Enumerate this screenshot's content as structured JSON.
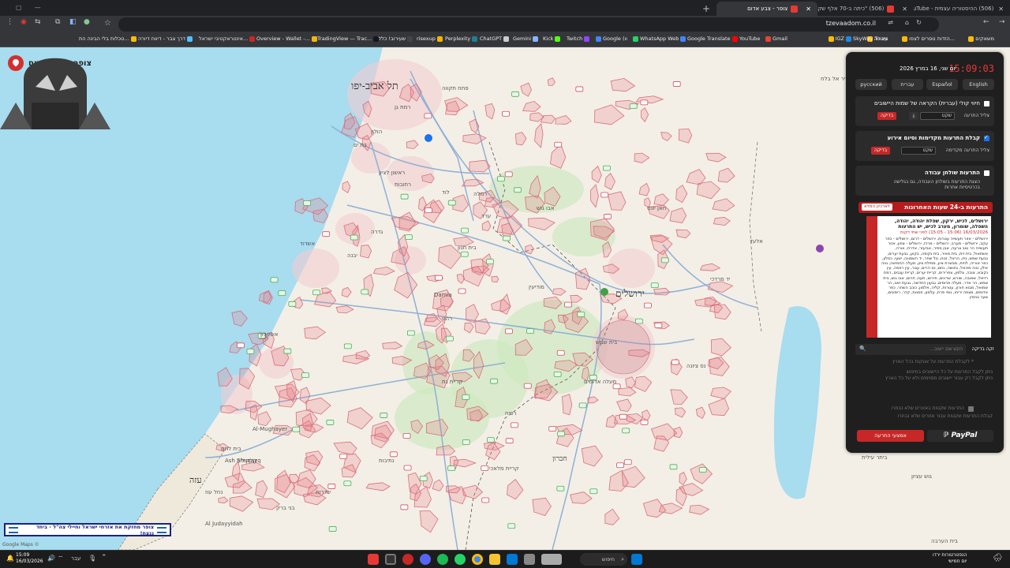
{
  "browser": {
    "tabs": [
      {
        "title": "(506) ההיסטוריה עצמית - YouTube",
        "active": false
      },
      {
        "title": "(506) \"כיתה ב-70 אלף שקל!\" ס...",
        "active": false
      },
      {
        "title": "צופר - צבע אדום",
        "active": true
      }
    ],
    "url": "tzevaadom.co.il",
    "bookmarks": [
      "משאקים",
      "הזדות נוסרים לצפו...",
      "עבודה",
      "IGZ",
      "SkyWay Tours",
      "Gmail",
      "YouTube",
      "Google Translate",
      "WhatsApp Web",
      "Google (וו",
      "Twitch",
      "Kick",
      "Gemini",
      "ChatGPT",
      "Perplexity",
      "risexup",
      "שעירוב! כללי",
      "TradingView — Trac...",
      "Overview - Wallet -...",
      "אינטראקטיבי ישראל...",
      "דרך צבר - דיווח דיורה",
      "טכלות בלי הבינה הת..."
    ]
  },
  "app": {
    "name": "צופר - צבע אדום",
    "banner": "צופר מחזקת את אזרחי ישראל וחיילי צה\"ל - ביחד ננצח!",
    "map_credit": "Google Maps ©"
  },
  "map": {
    "cities": [
      {
        "name": "תל אביב-יפו",
        "size": "big"
      },
      {
        "name": "ירושלים",
        "size": "big"
      },
      {
        "name": "עזה",
        "size": "mid"
      },
      {
        "name": "חברון",
        "size": "mid"
      }
    ],
    "places": [
      "רמת גן",
      "פתח תקווה",
      "הולון",
      "בת ים",
      "ראשון לציון",
      "רחובות",
      "לוד",
      "רמלה",
      "אשדוד",
      "אשקלון",
      "יבנה",
      "גדרה",
      "קריית גת",
      "מודיעין",
      "בית שמש",
      "מעלה אדומים",
      "בית לחם",
      "שדרות",
      "נתיבות",
      "רהט",
      "ערד",
      "קריית מלאכי",
      "נס ציונה",
      "אלעד",
      "ביתר עילית",
      "גוש עציון",
      "בית הערבה",
      "Al Judayyidah",
      "Ash Shuqayq",
      "Al-Mughayer",
      "דיר אל בלח",
      "חאן יונס",
      "בית חנון",
      "Damia",
      "רפיח",
      "אבו גוש",
      "בני ברק",
      "קלקיליה",
      "נחל עוז",
      "יד מרדכי"
    ]
  },
  "panel": {
    "time": "15:09:03",
    "date": "יום שני, 16 במרץ 2026",
    "languages": [
      "English",
      "Español",
      "עברית",
      "русский"
    ],
    "sections": {
      "voice": {
        "title": "חיווי קולי (עברית) הקראה של שמות היישובים",
        "sound_label": "צליל התרעה",
        "sound_value": "שקט",
        "test_label": "בדיקה",
        "checked": false
      },
      "early": {
        "title": "קבלת התרעות מקדימות וסיום אירוע",
        "sound_label": "צליל התרעה מקדימה",
        "sound_value": "שקט",
        "test_label": "בדיקה",
        "checked": true
      },
      "desktop": {
        "title": "התרעות שולחן עבודה",
        "subtitle": "הצגת התרעות בשולחן העבודה, גם בגלישה בכרטיסיות אחרות",
        "checked": false
      }
    },
    "alerts": {
      "title": "התרעות ב-24 שעות האחרונות",
      "button": "לארכיון המלא",
      "head": "ירושלים, לכיש, ירקון, שפלת יהודה, יהודה, השפלה, שומרון, מערב לכיש, יש התרעות",
      "time": "16/03/2026 (15:06 - 15:05) לפני שתי דקות",
      "text": "ירושלים - אזור תעשייה עטרות, ירושלים - דרום, ירושלים - כפר עקב, ירושלים - מערב, ירושלים - מרכז, ירושלים - צפון, אזור תעשייה הר טוב צרעה, אבן ספיר, אביעזר, אדרת, אורה, אשתאול, בית זית, בית מאיר, בית נקופה, בקוע, גבעת יערים, גבעת שמש, גיזו, הראל, זנוח, טל שחר, יד השמונה, ישעי, כסלון, כפר אוריה, לוזית, מבשרת ציון, מסילת ציון, מעלה החמישה, נווה אילן, נווה מיכאל, נחושה, נחם, נס הרים, עגור, עין ראפה, עין נקובא, צובה, צלפון, צפרירים, קריית יערים, קריית ענבים, רמת רזיאל, שואבה, שורש, שריגים, תירוש, תעוז, תרום, אבו גוש, בית שמש, הר אדר, מעלה אדומים, גבעון החדשה, גבעת זאב, הר שמואל, מבוא חורון, עטרות, קליה, אלמון, כוכב השחר, כפר אדומים, מצפה יריחו, נופי פרת, עלמון, פסגות, קדר, רימונים, שער בנימין"
    },
    "search": {
      "placeholder": "הקש שם יישוב...",
      "label": "זקה בדיקה"
    },
    "info": [
      "* לקבלת התרעות על אטקות בכל הארץ",
      "ניתן לקבל התרעות על כל היישובים בחיפוש",
      "ניתן לקבל רק עבור יישובים מסוימים ולא על כל הארץ",
      "התרעות שקטות באזורים שלא נבחרו",
      "קבלת התרעות שקטות עבור אזורים שלא נבחרו"
    ],
    "donate": "אמצעי התרעה",
    "paypal": "PayPal"
  },
  "taskbar": {
    "time": "15:09",
    "date": "16/03/2026",
    "search": "חיפוש",
    "lang": "עבר",
    "weather_title": "הנפטרטורות ירדו",
    "weather_sub": "יום חמישי"
  },
  "colors": {
    "sea": "#a8dcef",
    "land": "#f3efe6",
    "urban": "#f2cdd0",
    "green": "#cdeac0",
    "alert_red": "#c62828",
    "road": "#8fb0d6"
  }
}
